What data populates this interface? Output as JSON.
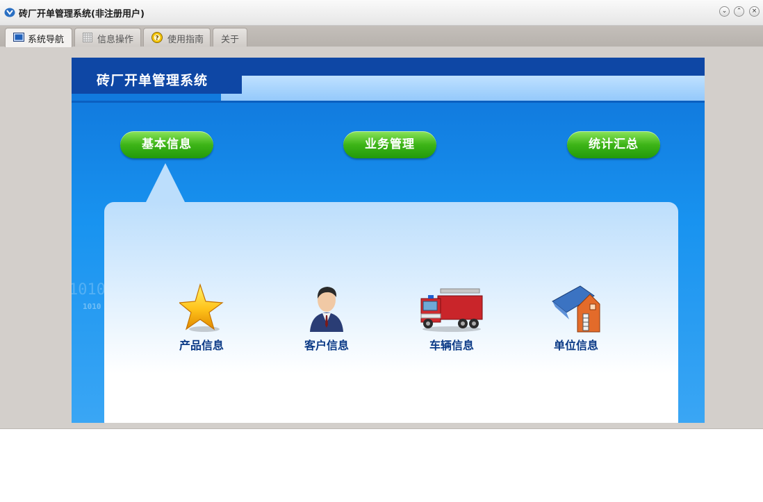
{
  "window": {
    "title": "砖厂开单管理系统(非注册用户)",
    "app_icon": "app-logo-icon",
    "controls": [
      "minimize-icon",
      "maximize-icon",
      "close-icon"
    ]
  },
  "tabs": [
    {
      "label": "系统导航",
      "icon": "monitor-icon",
      "active": true
    },
    {
      "label": "信息操作",
      "icon": "grid-icon",
      "active": false
    },
    {
      "label": "使用指南",
      "icon": "help-icon",
      "active": false
    },
    {
      "label": "关于",
      "icon": "",
      "active": false
    }
  ],
  "panel": {
    "title": "砖厂开单管理系统",
    "decor_text": [
      "1010",
      "1010"
    ]
  },
  "categories": [
    {
      "label": "基本信息",
      "selected": true
    },
    {
      "label": "业务管理",
      "selected": false
    },
    {
      "label": "统计汇总",
      "selected": false
    }
  ],
  "items": [
    {
      "label": "产品信息",
      "icon": "star-icon"
    },
    {
      "label": "客户信息",
      "icon": "person-icon"
    },
    {
      "label": "车辆信息",
      "icon": "truck-icon"
    },
    {
      "label": "单位信息",
      "icon": "building-icon"
    }
  ],
  "colors": {
    "accent_green": "#3db417",
    "panel_blue": "#1893f0",
    "header_dark_blue": "#0e47a5",
    "label_blue": "#0b3a86"
  }
}
